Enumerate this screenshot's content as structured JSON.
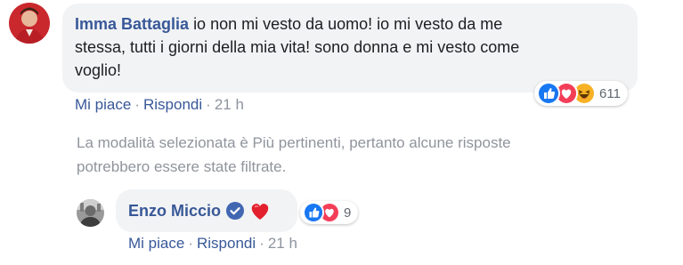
{
  "comment1": {
    "author": "Imma Battaglia",
    "text_line1": "io non mi vesto da uomo! io mi vesto da me",
    "text_line2": "stessa, tutti i giorni della mia vita! sono donna e mi vesto come",
    "text_line3": "voglio!",
    "like_label": "Mi piace",
    "reply_label": "Rispondi",
    "separator": "·",
    "time": "21 h",
    "reactions": [
      "like-icon",
      "love-icon",
      "haha-icon"
    ],
    "reaction_count": "611"
  },
  "notice": {
    "text_line1": "La modalità selezionata è Più pertinenti, pertanto alcune risposte",
    "text_line2": "potrebbero essere state filtrate."
  },
  "reply1": {
    "author": "Enzo Miccio",
    "verified_icon": "verified-badge-icon",
    "emoji": "❤️",
    "like_label": "Mi piace",
    "reply_label": "Rispondi",
    "separator": "·",
    "time": "21 h",
    "reactions": [
      "like-icon",
      "love-icon"
    ],
    "reaction_count": "9"
  },
  "colors": {
    "link": "#385898",
    "bubble": "#f2f3f5",
    "muted": "#90949c",
    "like": "#1877f2",
    "love": "#f33e58",
    "haha": "#f7b125"
  }
}
